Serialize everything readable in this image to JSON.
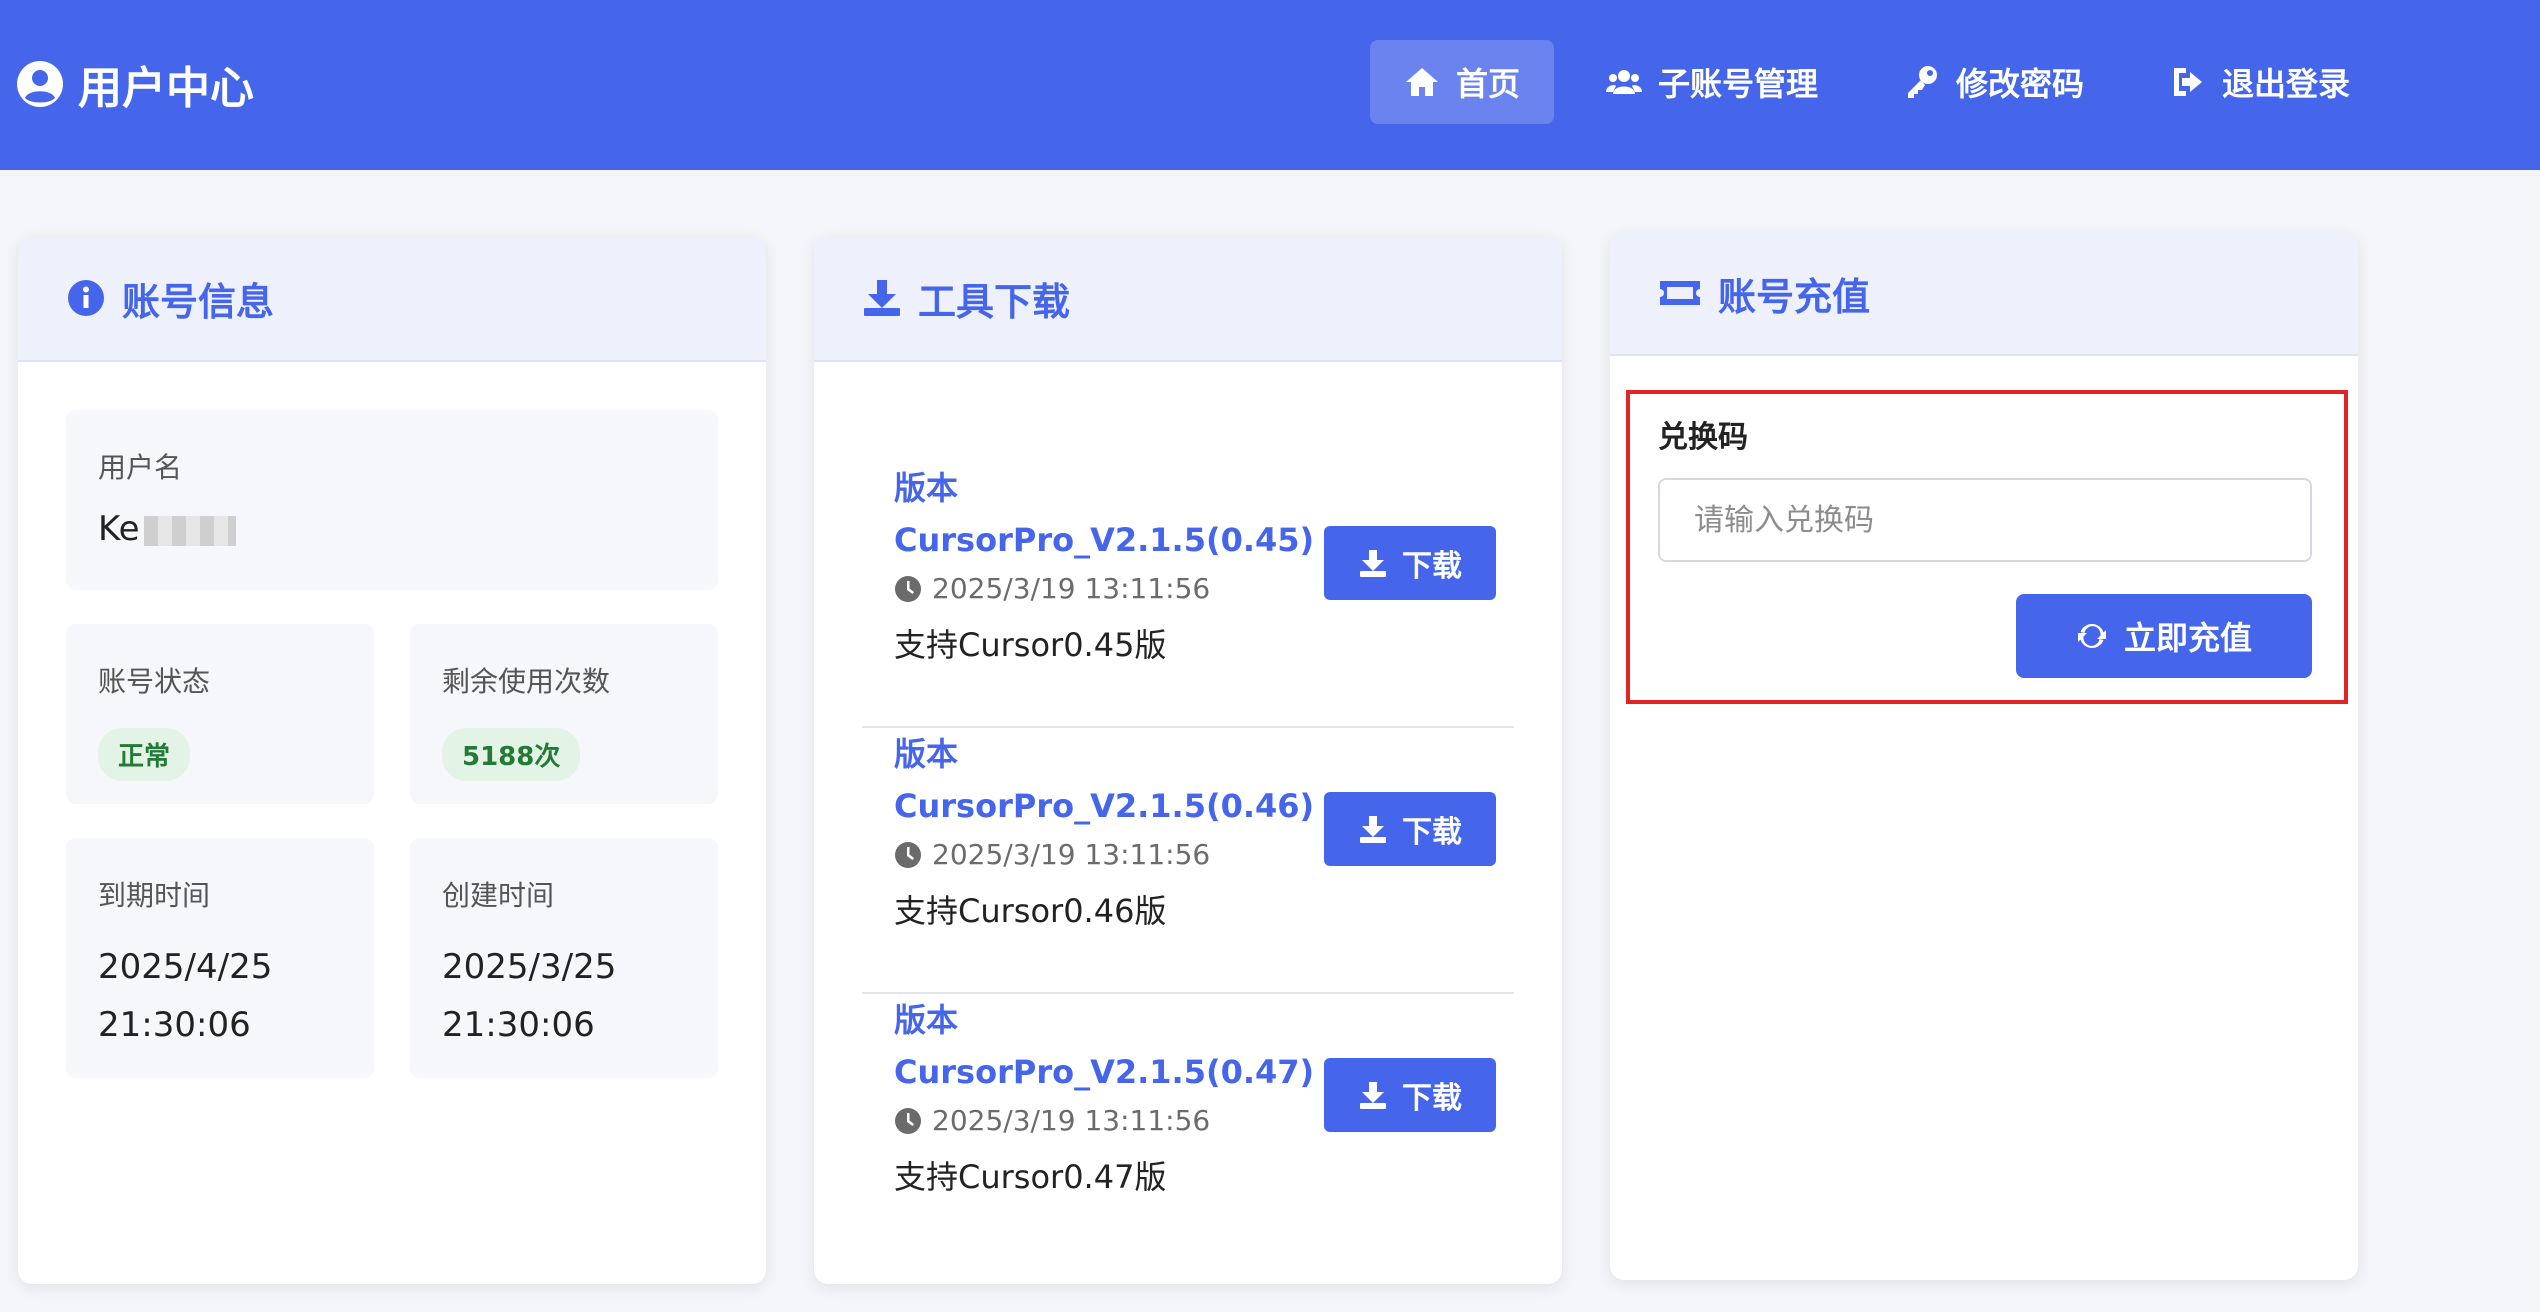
{
  "header": {
    "title": "用户中心",
    "nav": [
      {
        "label": "首页",
        "icon": "home-icon",
        "active": true
      },
      {
        "label": "子账号管理",
        "icon": "users-icon"
      },
      {
        "label": "修改密码",
        "icon": "key-icon"
      },
      {
        "label": "退出登录",
        "icon": "logout-icon"
      }
    ]
  },
  "account": {
    "title": "账号信息",
    "username_label": "用户名",
    "username_value": "Ke",
    "status_label": "账号状态",
    "status_value": "正常",
    "remaining_label": "剩余使用次数",
    "remaining_value": "5188次",
    "expire_label": "到期时间",
    "expire_date": "2025/4/25",
    "expire_time": "21:30:06",
    "created_label": "创建时间",
    "created_date": "2025/3/25",
    "created_time": "21:30:06"
  },
  "downloads": {
    "title": "工具下载",
    "button_label": "下载",
    "items": [
      {
        "prefix": "版本",
        "name": "CursorPro_V2.1.5(0.45)",
        "date": "2025/3/19 13:11:56",
        "note": "支持Cursor0.45版"
      },
      {
        "prefix": "版本",
        "name": "CursorPro_V2.1.5(0.46)",
        "date": "2025/3/19 13:11:56",
        "note": "支持Cursor0.46版"
      },
      {
        "prefix": "版本",
        "name": "CursorPro_V2.1.5(0.47)",
        "date": "2025/3/19 13:11:56",
        "note": "支持Cursor0.47版"
      }
    ]
  },
  "recharge": {
    "title": "账号充值",
    "code_label": "兑换码",
    "code_placeholder": "请输入兑换码",
    "code_value": "",
    "button_label": "立即充值"
  },
  "colors": {
    "primary": "#4565ea",
    "success_bg": "#e3f3e6",
    "success_text": "#237a37",
    "highlight": "#e12424"
  }
}
